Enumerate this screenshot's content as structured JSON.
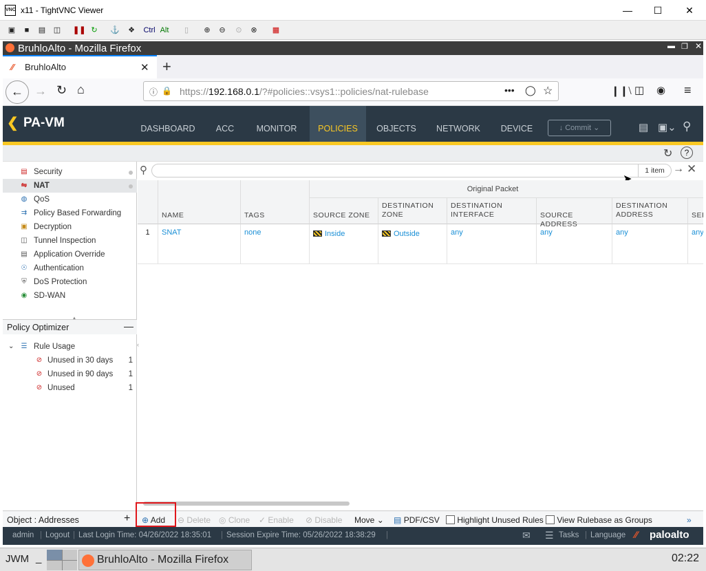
{
  "vnc": {
    "title": "x11 - TightVNC Viewer",
    "minimize_icon": "minimize-icon",
    "toolbar_ctrl": "Ctrl",
    "toolbar_alt": "Alt"
  },
  "firefox": {
    "window_title": "BruhloAlto - Mozilla Firefox",
    "tab_title": "BruhloAlto",
    "url_prefix": "https://",
    "url_host": "192.168.0.1",
    "url_path": "/?#policies::vsys1::policies/nat-rulebase"
  },
  "pan": {
    "brand": "PA-VM",
    "nav": [
      "DASHBOARD",
      "ACC",
      "MONITOR",
      "POLICIES",
      "OBJECTS",
      "NETWORK",
      "DEVICE"
    ],
    "commit_label": "Commit",
    "accent": "#fac823"
  },
  "sidebar": {
    "items": [
      {
        "label": "Security",
        "icon": "security-rule-icon"
      },
      {
        "label": "NAT",
        "icon": "nat-icon"
      },
      {
        "label": "QoS",
        "icon": "qos-icon"
      },
      {
        "label": "Policy Based Forwarding",
        "icon": "pbf-icon"
      },
      {
        "label": "Decryption",
        "icon": "lock-icon"
      },
      {
        "label": "Tunnel Inspection",
        "icon": "tunnel-icon"
      },
      {
        "label": "Application Override",
        "icon": "app-override-icon"
      },
      {
        "label": "Authentication",
        "icon": "auth-icon"
      },
      {
        "label": "DoS Protection",
        "icon": "shield-icon"
      },
      {
        "label": "SD-WAN",
        "icon": "globe-icon"
      }
    ],
    "optimizer_title": "Policy Optimizer",
    "rule_usage_label": "Rule Usage",
    "rule_usage_items": [
      {
        "label": "Unused in 30 days",
        "count": "1"
      },
      {
        "label": "Unused in 90 days",
        "count": "1"
      },
      {
        "label": "Unused",
        "count": "1"
      }
    ],
    "object_label": "Object : Addresses"
  },
  "grid": {
    "item_count": "1 item",
    "group_header": "Original Packet",
    "columns": [
      "NAME",
      "TAGS",
      "SOURCE ZONE",
      "DESTINATION ZONE",
      "DESTINATION INTERFACE",
      "SOURCE ADDRESS",
      "DESTINATION ADDRESS",
      "SER"
    ],
    "rows": [
      {
        "num": "1",
        "name": "SNAT",
        "tags": "none",
        "source_zone": "Inside",
        "dest_zone": "Outside",
        "dest_interface": "any",
        "source_address": "any",
        "dest_address": "any",
        "service": "any"
      }
    ]
  },
  "actions": {
    "add": "Add",
    "delete": "Delete",
    "clone": "Clone",
    "enable": "Enable",
    "disable": "Disable",
    "move": "Move",
    "pdf": "PDF/CSV",
    "highlight_unused": "Highlight Unused Rules",
    "view_groups": "View Rulebase as Groups"
  },
  "status": {
    "user": "admin",
    "logout": "Logout",
    "last_login": "Last Login Time: 04/26/2022 18:35:01",
    "session_expire": "Session Expire Time: 05/26/2022 18:38:29",
    "tasks": "Tasks",
    "language": "Language",
    "brand": "paloalto"
  },
  "taskbar": {
    "wm": "JWM",
    "underscore": "_",
    "task": "BruhloAlto - Mozilla Firefox",
    "clock": "02:22"
  }
}
